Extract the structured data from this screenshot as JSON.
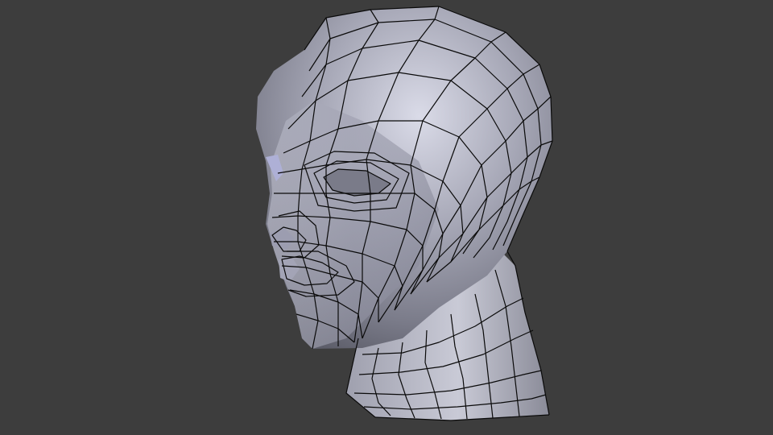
{
  "viewport": {
    "background_color": "#3d3d3d",
    "mode": "3d-viewport"
  },
  "model": {
    "object": "head-mesh",
    "surface_color": "#8e8fa0",
    "highlight_color": "#d8d9e6",
    "shadow_color": "#5b5c6a",
    "wire_color": "#0a0a0a",
    "display": "solid-with-wireframe"
  }
}
